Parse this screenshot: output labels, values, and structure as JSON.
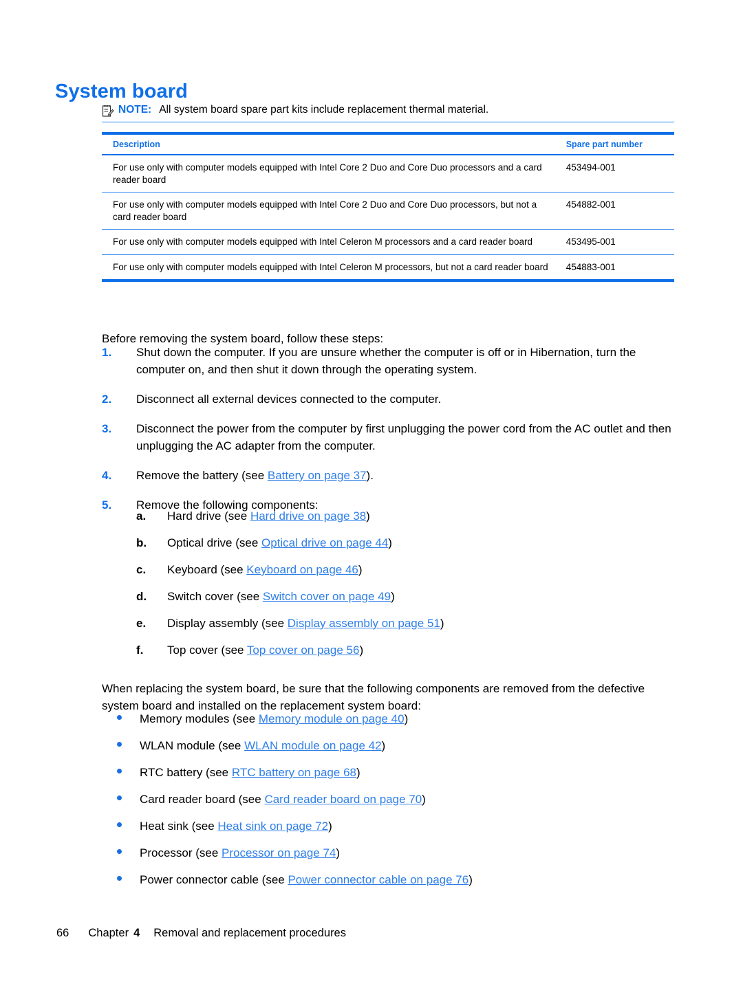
{
  "document": {
    "title": "System board",
    "accent_color": "#0f6fe8",
    "link_color": "#2f7fe8"
  },
  "note": {
    "icon": "note-pad-icon",
    "label": "NOTE:",
    "text": "All system board spare part kits include replacement thermal material."
  },
  "table": {
    "headers": {
      "description": "Description",
      "spare_part_number": "Spare part number"
    },
    "rows": [
      {
        "description": "For use only with computer models equipped with Intel Core 2 Duo and Core Duo processors and a card reader board",
        "spare_part_number": "453494-001"
      },
      {
        "description": "For use only with computer models equipped with Intel Core 2 Duo and Core Duo processors, but not a card reader board",
        "spare_part_number": "454882-001"
      },
      {
        "description": "For use only with computer models equipped with Intel Celeron M processors and a card reader board",
        "spare_part_number": "453495-001"
      },
      {
        "description": "For use only with computer models equipped with Intel Celeron M processors, but not a card reader board",
        "spare_part_number": "454883-001"
      }
    ]
  },
  "intro_paragraph": "Before removing the system board, follow these steps:",
  "steps": [
    {
      "marker": "1.",
      "text": "Shut down the computer. If you are unsure whether the computer is off or in Hibernation, turn the computer on, and then shut it down through the operating system."
    },
    {
      "marker": "2.",
      "text": "Disconnect all external devices connected to the computer."
    },
    {
      "marker": "3.",
      "text": "Disconnect the power from the computer by first unplugging the power cord from the AC outlet and then unplugging the AC adapter from the computer."
    },
    {
      "marker": "4.",
      "text_before": "Remove the battery (see ",
      "link": "Battery on page 37",
      "text_after": ")."
    },
    {
      "marker": "5.",
      "text": "Remove the following components:"
    }
  ],
  "substeps": [
    {
      "marker": "a.",
      "text_before": "Hard drive (see ",
      "link": "Hard drive on page 38",
      "text_after": ")"
    },
    {
      "marker": "b.",
      "text_before": "Optical drive (see ",
      "link": "Optical drive on page 44",
      "text_after": ")"
    },
    {
      "marker": "c.",
      "text_before": "Keyboard (see ",
      "link": "Keyboard on page 46",
      "text_after": ")"
    },
    {
      "marker": "d.",
      "text_before": "Switch cover (see ",
      "link": "Switch cover on page 49",
      "text_after": ")"
    },
    {
      "marker": "e.",
      "text_before": "Display assembly (see ",
      "link": "Display assembly on page 51",
      "text_after": ")"
    },
    {
      "marker": "f.",
      "text_before": "Top cover (see ",
      "link": "Top cover on page 56",
      "text_after": ")"
    }
  ],
  "replace_paragraph": "When replacing the system board, be sure that the following components are removed from the defective system board and installed on the replacement system board:",
  "bullets": [
    {
      "text_before": "Memory modules (see ",
      "link": "Memory module on page 40",
      "text_after": ")"
    },
    {
      "text_before": "WLAN module (see ",
      "link": "WLAN module on page 42",
      "text_after": ")"
    },
    {
      "text_before": "RTC battery (see ",
      "link": "RTC battery on page 68",
      "text_after": ")"
    },
    {
      "text_before": "Card reader board (see ",
      "link": "Card reader board on page 70",
      "text_after": ")"
    },
    {
      "text_before": "Heat sink (see ",
      "link": "Heat sink on page 72",
      "text_after": ")"
    },
    {
      "text_before": "Processor (see ",
      "link": "Processor on page 74",
      "text_after": ")"
    },
    {
      "text_before": "Power connector cable (see ",
      "link": "Power connector cable on page 76",
      "text_after": ")"
    }
  ],
  "footer": {
    "page_number": "66",
    "chapter_word": "Chapter",
    "chapter_number": "4",
    "chapter_title": "Removal and replacement procedures"
  }
}
